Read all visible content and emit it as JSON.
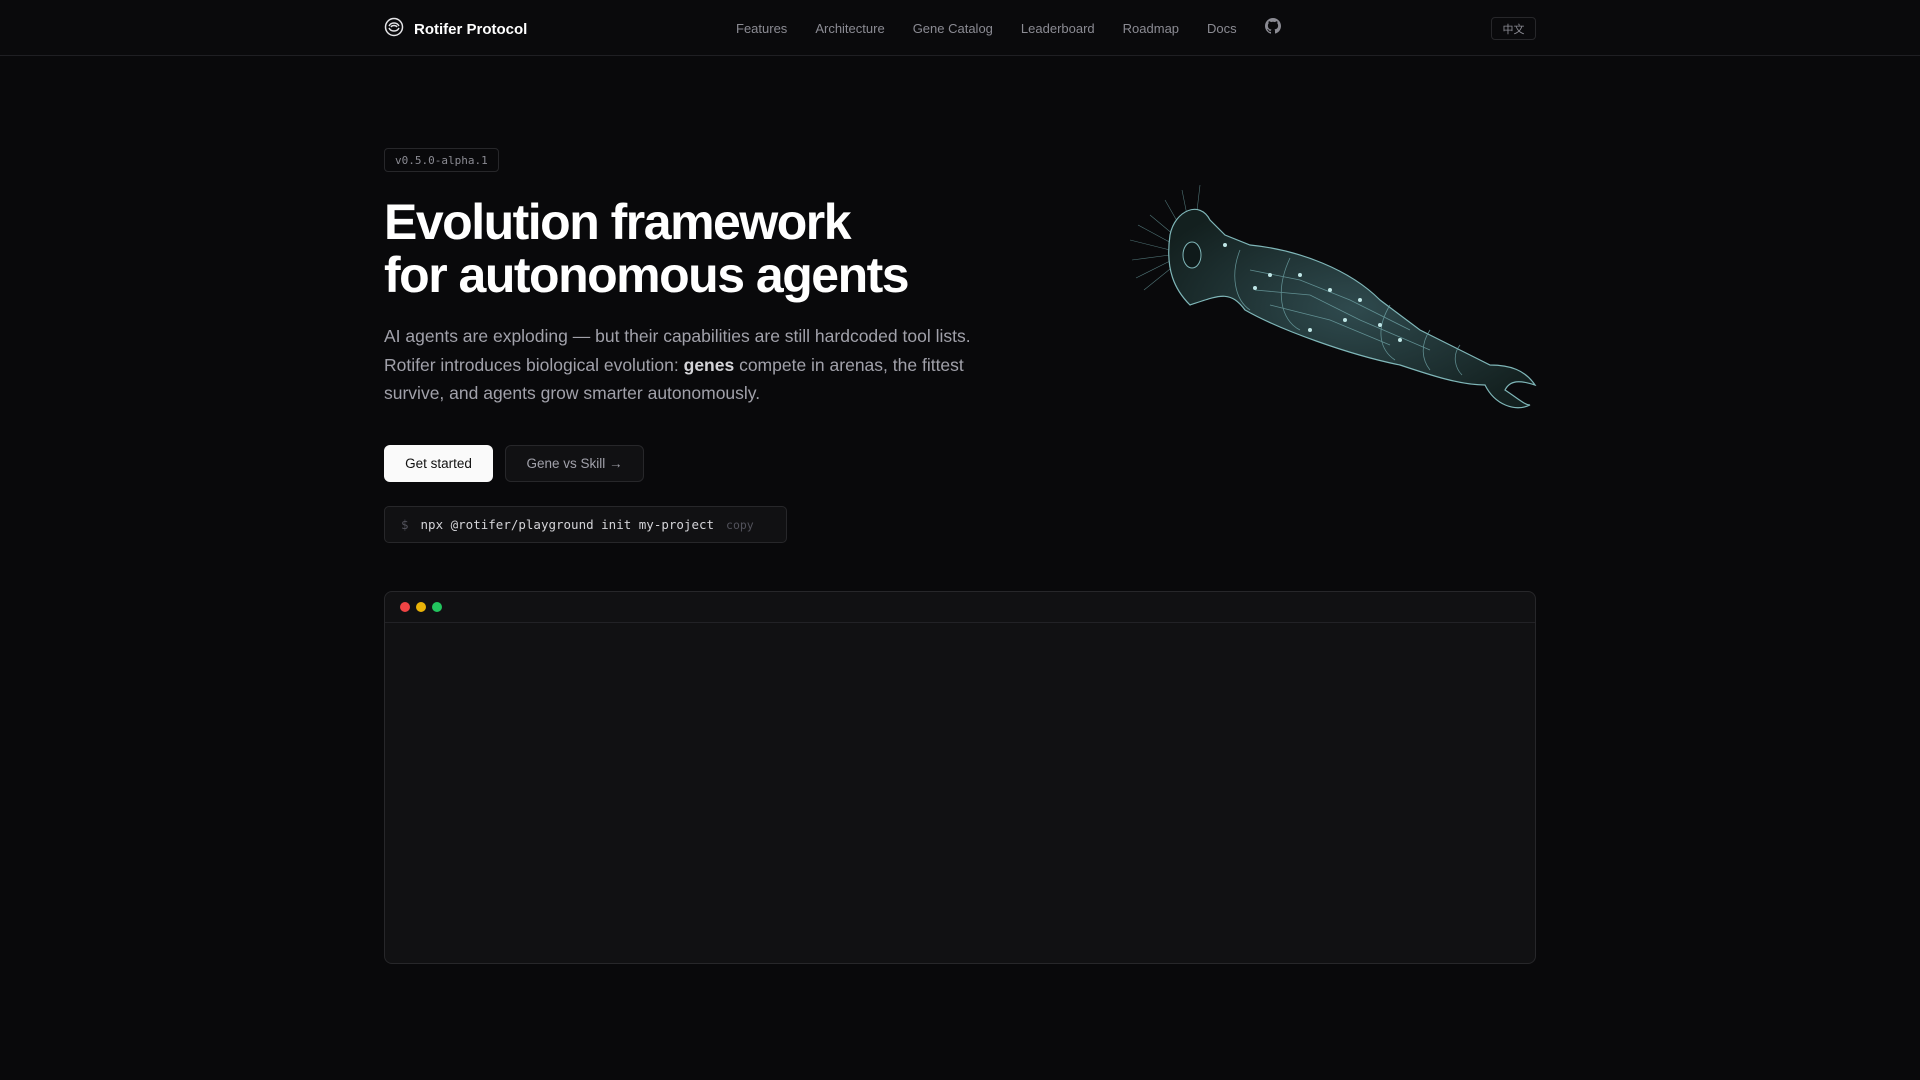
{
  "nav": {
    "brand": "Rotifer Protocol",
    "links": [
      "Features",
      "Architecture",
      "Gene Catalog",
      "Leaderboard",
      "Roadmap",
      "Docs"
    ],
    "lang_button": "中文"
  },
  "hero": {
    "version": "v0.5.0-alpha.1",
    "title_line1": "Evolution framework",
    "title_line2": "for autonomous agents",
    "lead_part1": "AI agents are exploding — but their capabilities are still hardcoded tool lists. Rotifer introduces biological evolution: ",
    "lead_bold": "genes",
    "lead_part2": " compete in arenas, the fittest survive, and agents grow smarter autonomously.",
    "primary_button": "Get started",
    "secondary_button": "Gene vs Skill →",
    "command_prompt": "$",
    "command": "npx @rotifer/playground init my-project",
    "copy_label": "copy"
  },
  "terminal": {
    "dot_colors": [
      "#ef4444",
      "#eab308",
      "#22c55e"
    ]
  }
}
